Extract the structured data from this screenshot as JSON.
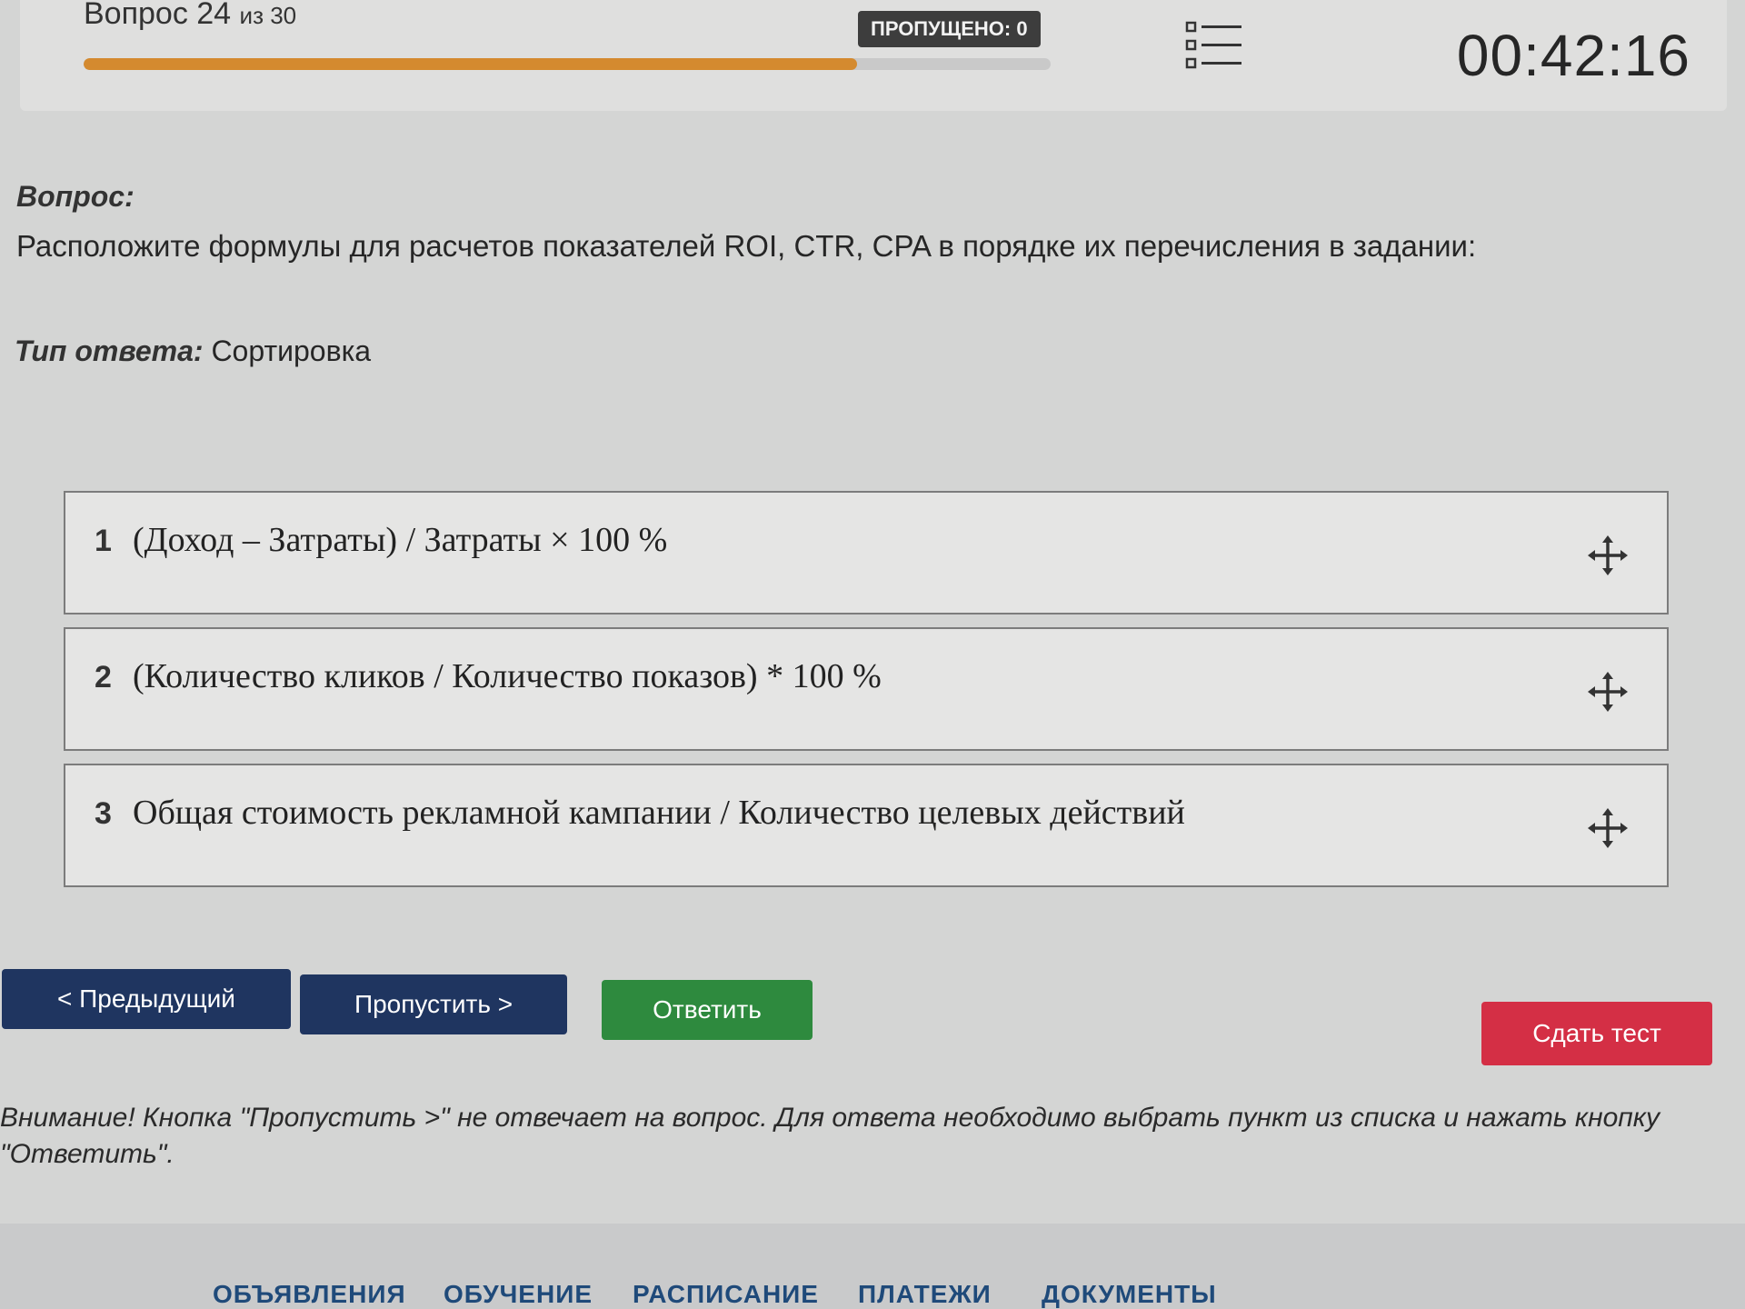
{
  "header": {
    "question_prefix": "Вопрос 24",
    "question_of": "из 30",
    "progress_fraction": 0.8,
    "skipped_label": "ПРОПУЩЕНО: 0",
    "list_icon": "list-icon",
    "timer": "00:42:16"
  },
  "question": {
    "label": "Вопрос:",
    "text": "Расположите формулы для расчетов показателей ROI, CTR, CPA в порядке их перечисления в задании:",
    "type_label": "Тип ответа:",
    "type_value": "Сортировка"
  },
  "items": [
    {
      "num": "1",
      "text": "(Доход – Затраты) / Затраты × 100 %",
      "icon": "move-icon"
    },
    {
      "num": "2",
      "text": "(Количество кликов / Количество показов) * 100 %",
      "icon": "move-icon"
    },
    {
      "num": "3",
      "text": "Общая стоимость рекламной кампании / Количество целевых действий",
      "icon": "move-icon"
    }
  ],
  "buttons": {
    "prev": "< Предыдущий",
    "skip": "Пропустить >",
    "answer": "Ответить",
    "submit": "Сдать тест"
  },
  "warning": "Внимание! Кнопка \"Пропустить >\" не отвечает на вопрос. Для ответа необходимо выбрать пункт из списка и нажать кнопку \"Ответить\".",
  "nav": [
    "ОБЪЯВЛЕНИЯ",
    "ОБУЧЕНИЕ",
    "РАСПИСАНИЕ",
    "ПЛАТЕЖИ",
    "ДОКУМЕНТЫ"
  ],
  "colors": {
    "progress": "#d48a2f",
    "primary": "#1f3560",
    "answer": "#2e8a3e",
    "submit": "#d42f45",
    "nav_link": "#1f4a7a"
  }
}
